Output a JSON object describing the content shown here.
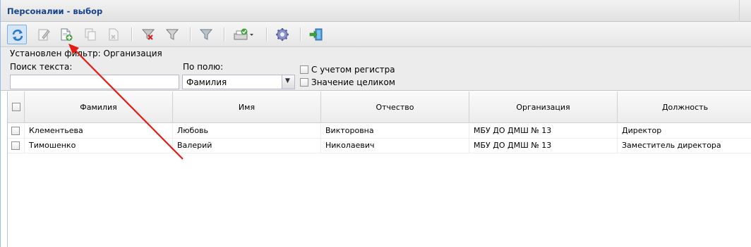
{
  "window": {
    "title": "Персоналии - выбор"
  },
  "toolbar": {
    "buttons": [
      {
        "icon": "refresh-icon",
        "name": "refresh-button"
      },
      {
        "icon": "edit-icon",
        "name": "edit-button"
      },
      {
        "icon": "add-document-icon",
        "name": "add-button"
      },
      {
        "icon": "copy-document-icon",
        "name": "copy-button"
      },
      {
        "icon": "delete-document-icon",
        "name": "delete-button"
      },
      {
        "icon": "clear-filter-icon",
        "name": "clear-filter-button"
      },
      {
        "icon": "filter-icon",
        "name": "filter-button"
      },
      {
        "icon": "advanced-filter-icon",
        "name": "advanced-filter-button"
      },
      {
        "icon": "print-icon",
        "name": "print-button"
      },
      {
        "icon": "gear-icon",
        "name": "settings-button"
      },
      {
        "icon": "exit-icon",
        "name": "exit-button"
      }
    ]
  },
  "filter": {
    "status_text": "Установлен фильтр: Организация",
    "search_label": "Поиск текста:",
    "search_value": "",
    "field_label": "По полю:",
    "field_value": "Фамилия",
    "case_label": "С учетом регистра",
    "whole_label": "Значение целиком"
  },
  "grid": {
    "columns": [
      "Фамилия",
      "Имя",
      "Отчество",
      "Организация",
      "Должность"
    ],
    "rows": [
      [
        "Клементьева",
        "Любовь",
        "Викторовна",
        "МБУ ДО ДМШ № 13",
        "Директор"
      ],
      [
        "Тимошенко",
        "Валерий",
        "Николаевич",
        "МБУ ДО ДМШ № 13",
        "Заместитель директора"
      ]
    ]
  },
  "colors": {
    "title_text": "#15428b",
    "annotation_arrow": "#e41b17",
    "selection_border": "#7eadd9"
  }
}
